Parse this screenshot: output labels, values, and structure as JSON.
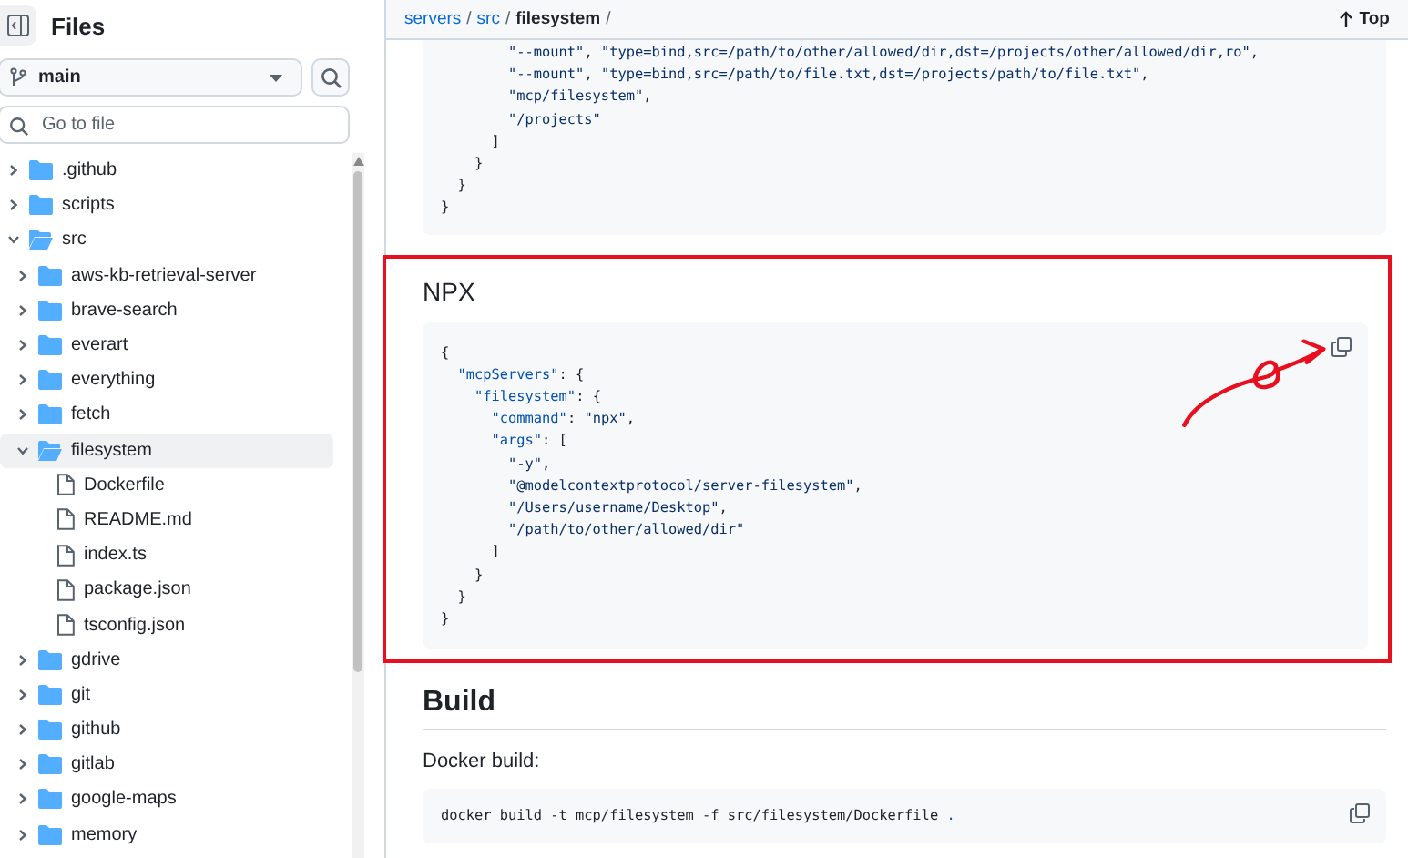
{
  "sidebar": {
    "title": "Files",
    "branch": "main",
    "search": {
      "placeholder": "Go to file"
    },
    "tree": [
      {
        "name": ".github",
        "kind": "folder",
        "expanded": false,
        "selected": false
      },
      {
        "name": "scripts",
        "kind": "folder",
        "expanded": false,
        "selected": false
      },
      {
        "name": "src",
        "kind": "folder",
        "expanded": true,
        "selected": false,
        "children": [
          {
            "name": "aws-kb-retrieval-server",
            "kind": "folder",
            "expanded": false,
            "selected": false
          },
          {
            "name": "brave-search",
            "kind": "folder",
            "expanded": false,
            "selected": false
          },
          {
            "name": "everart",
            "kind": "folder",
            "expanded": false,
            "selected": false
          },
          {
            "name": "everything",
            "kind": "folder",
            "expanded": false,
            "selected": false
          },
          {
            "name": "fetch",
            "kind": "folder",
            "expanded": false,
            "selected": false
          },
          {
            "name": "filesystem",
            "kind": "folder",
            "expanded": true,
            "selected": true,
            "children": [
              {
                "name": "Dockerfile",
                "kind": "file",
                "selected": false
              },
              {
                "name": "README.md",
                "kind": "file",
                "selected": false
              },
              {
                "name": "index.ts",
                "kind": "file",
                "selected": false
              },
              {
                "name": "package.json",
                "kind": "file",
                "selected": false
              },
              {
                "name": "tsconfig.json",
                "kind": "file",
                "selected": false
              }
            ]
          },
          {
            "name": "gdrive",
            "kind": "folder",
            "expanded": false,
            "selected": false
          },
          {
            "name": "git",
            "kind": "folder",
            "expanded": false,
            "selected": false
          },
          {
            "name": "github",
            "kind": "folder",
            "expanded": false,
            "selected": false
          },
          {
            "name": "gitlab",
            "kind": "folder",
            "expanded": false,
            "selected": false
          },
          {
            "name": "google-maps",
            "kind": "folder",
            "expanded": false,
            "selected": false
          },
          {
            "name": "memory",
            "kind": "folder",
            "expanded": false,
            "selected": false
          }
        ]
      }
    ]
  },
  "breadcrumb": {
    "links": [
      "servers",
      "src"
    ],
    "current": "filesystem",
    "separator": "/",
    "top": "Top"
  },
  "sections": [
    {
      "kind": "code",
      "lines": [
        [
          {
            "text": "        \"--mount\"",
            "kind": "string"
          },
          {
            "text": ", ",
            "kind": "plain"
          },
          {
            "text": "\"type=bind,src=/path/to/other/allowed/dir,dst=/projects/other/allowed/dir,ro\"",
            "kind": "string"
          },
          {
            "text": ",",
            "kind": "plain"
          }
        ],
        [
          {
            "text": "        \"--mount\"",
            "kind": "string"
          },
          {
            "text": ", ",
            "kind": "plain"
          },
          {
            "text": "\"type=bind,src=/path/to/file.txt,dst=/projects/path/to/file.txt\"",
            "kind": "string"
          },
          {
            "text": ",",
            "kind": "plain"
          }
        ],
        [
          {
            "text": "        \"mcp/filesystem\"",
            "kind": "string"
          },
          {
            "text": ",",
            "kind": "plain"
          }
        ],
        [
          {
            "text": "        \"/projects\"",
            "kind": "string"
          }
        ],
        [
          {
            "text": "      ]",
            "kind": "plain"
          }
        ],
        [
          {
            "text": "    }",
            "kind": "plain"
          }
        ],
        [
          {
            "text": "  }",
            "kind": "plain"
          }
        ],
        [
          {
            "text": "}",
            "kind": "plain"
          }
        ]
      ]
    },
    {
      "kind": "subheading",
      "text": "NPX",
      "highlighted": true
    },
    {
      "kind": "code",
      "highlighted": true,
      "copy": true,
      "lines": [
        [
          {
            "text": "{",
            "kind": "plain"
          }
        ],
        [
          {
            "text": "  \"mcpServers\"",
            "kind": "key"
          },
          {
            "text": ": {",
            "kind": "plain"
          }
        ],
        [
          {
            "text": "    \"filesystem\"",
            "kind": "key"
          },
          {
            "text": ": {",
            "kind": "plain"
          }
        ],
        [
          {
            "text": "      \"command\"",
            "kind": "key"
          },
          {
            "text": ": ",
            "kind": "plain"
          },
          {
            "text": "\"npx\"",
            "kind": "string"
          },
          {
            "text": ",",
            "kind": "plain"
          }
        ],
        [
          {
            "text": "      \"args\"",
            "kind": "key"
          },
          {
            "text": ": [",
            "kind": "plain"
          }
        ],
        [
          {
            "text": "        \"-y\"",
            "kind": "string"
          },
          {
            "text": ",",
            "kind": "plain"
          }
        ],
        [
          {
            "text": "        \"@modelcontextprotocol/server-filesystem\"",
            "kind": "string"
          },
          {
            "text": ",",
            "kind": "plain"
          }
        ],
        [
          {
            "text": "        \"/Users/username/Desktop\"",
            "kind": "string"
          },
          {
            "text": ",",
            "kind": "plain"
          }
        ],
        [
          {
            "text": "        \"/path/to/other/allowed/dir\"",
            "kind": "string"
          }
        ],
        [
          {
            "text": "      ]",
            "kind": "plain"
          }
        ],
        [
          {
            "text": "    }",
            "kind": "plain"
          }
        ],
        [
          {
            "text": "  }",
            "kind": "plain"
          }
        ],
        [
          {
            "text": "}",
            "kind": "plain"
          }
        ]
      ]
    },
    {
      "kind": "heading",
      "text": "Build"
    },
    {
      "kind": "paragraph",
      "text": "Docker build:"
    },
    {
      "kind": "code",
      "copy": true,
      "lines": [
        [
          {
            "text": "docker build -t mcp/filesystem -f src/filesystem/Dockerfile ",
            "kind": "plain"
          },
          {
            "text": ".",
            "kind": "key"
          }
        ]
      ]
    }
  ]
}
